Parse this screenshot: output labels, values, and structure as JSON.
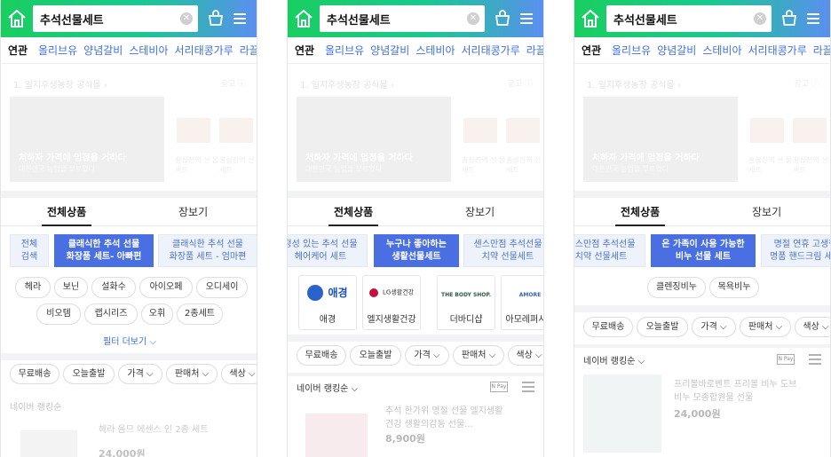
{
  "search": {
    "query": "추석선물세트"
  },
  "related": {
    "label": "연관",
    "items": [
      "올리브유",
      "양념갈비",
      "스테비아",
      "서리태콩가루",
      "라끌렛"
    ]
  },
  "faded_section": {
    "title": "1. 일지후생농장 공식몰 ›",
    "ad": "광고 ⓘ",
    "banner_title": "처하자 가격에 엄정을 거하다",
    "banner_sub": "대한민국 농업을 부르었다",
    "thumb_captions": [
      "홍삼진액 선 물세트",
      "홍삼진액 선 물세트"
    ]
  },
  "tabs": {
    "all": "전체상품",
    "shopping": "장보기"
  },
  "screen1": {
    "cats": [
      {
        "label": "전체\n검색"
      },
      {
        "label": "클래식한 추석 선물\n화장품 세트- 아빠편",
        "active": true
      },
      {
        "label": "클래식한 추석 선물\n화장품 세트 - 엄마편"
      }
    ],
    "pills_row1": [
      "헤라",
      "보닌",
      "설화수",
      "아이오페",
      "오디세이"
    ],
    "pills_row2": [
      "비오템",
      "랩시리즈",
      "오휘",
      "2종세트"
    ],
    "more_filter": "필터 더보기",
    "filters": [
      "무료배송",
      "오늘출발",
      "가격",
      "판매처",
      "색상"
    ],
    "ranking": "네이버 랭킹순",
    "product_faded": {
      "title": "헤라 옴므 에센스 인 2종 세트",
      "price": "24,000원"
    }
  },
  "screen2": {
    "cats": [
      {
        "label": "정성 있는 추석 선물\n헤어케어 세트"
      },
      {
        "label": "누구나 좋아하는\n생활선물세트",
        "active": true
      },
      {
        "label": "센스만점 추석선물\n치약 선물세트"
      }
    ],
    "brands": [
      {
        "name": "애경",
        "logo": "애경"
      },
      {
        "name": "엘지생활건강",
        "logo": "LG생활건강"
      },
      {
        "name": "더바디샵",
        "logo": "THE BODY SHOP."
      },
      {
        "name": "아모레퍼시픽",
        "logo": "AMORE"
      }
    ],
    "filters": [
      "무료배송",
      "오늘출발",
      "가격",
      "판매처",
      "색상"
    ],
    "ranking": "네이버 랭킹순",
    "product_faded": {
      "title": "추석 한가위 명절 선물 엘지생활건강 생활의감동 선물...",
      "price": "8,900원"
    }
  },
  "screen3": {
    "cats": [
      {
        "label": "센스만점 추석선물\n치약 선물세트"
      },
      {
        "label": "온 가족이 사용 가능한\n비누 선물 세트",
        "active": true
      },
      {
        "label": "명절 연휴 고생한\n명품 핸드크림 세트"
      }
    ],
    "pills": [
      "클렌징비누",
      "목욕비누"
    ],
    "filters": [
      "무료배송",
      "오늘출발",
      "가격",
      "판매처",
      "색상"
    ],
    "ranking": "네이버 랭킹순",
    "product_faded": {
      "title": "프리볼바로벤트 프리볼 비누 도브 비누 모종합원물 선물",
      "price": "24,000원"
    }
  },
  "npay": "N Pay"
}
